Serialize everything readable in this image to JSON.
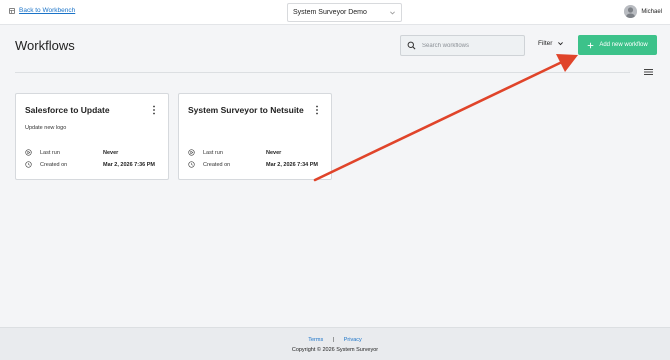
{
  "topbar": {
    "back_label": "Back to Workbench",
    "project_name": "System Surveyor Demo",
    "user_name": "Michael"
  },
  "header": {
    "title": "Workflows",
    "search_placeholder": "Search workflows",
    "filter_label": "Filter",
    "add_label": "Add new workflow"
  },
  "cards": [
    {
      "title": "Salesforce to Update",
      "description": "Update new logo",
      "last_run_label": "Last run",
      "last_run": "Never",
      "created_label": "Created on",
      "created": "Mar 2, 2026 7:36 PM"
    },
    {
      "title": "System Surveyor to Netsuite",
      "description": "",
      "last_run_label": "Last run",
      "last_run": "Never",
      "created_label": "Created on",
      "created": "Mar 2, 2026 7:34 PM"
    }
  ],
  "footer": {
    "terms_label": "Terms",
    "separator": "|",
    "privacy_label": "Privacy",
    "copyright": "Copyright © 2026 System Surveyor"
  },
  "colors": {
    "accent": "#3cc28a",
    "link": "#1a73c8",
    "annotation_arrow": "#e0442a"
  },
  "icons": {
    "back": "back-to-workbench-icon",
    "chevron": "chevron-down-icon",
    "search": "search-icon",
    "add": "plus-icon",
    "menu": "hamburger-menu-icon",
    "kebab": "more-vertical-icon",
    "play": "play-circle-icon",
    "clock": "clock-icon"
  }
}
